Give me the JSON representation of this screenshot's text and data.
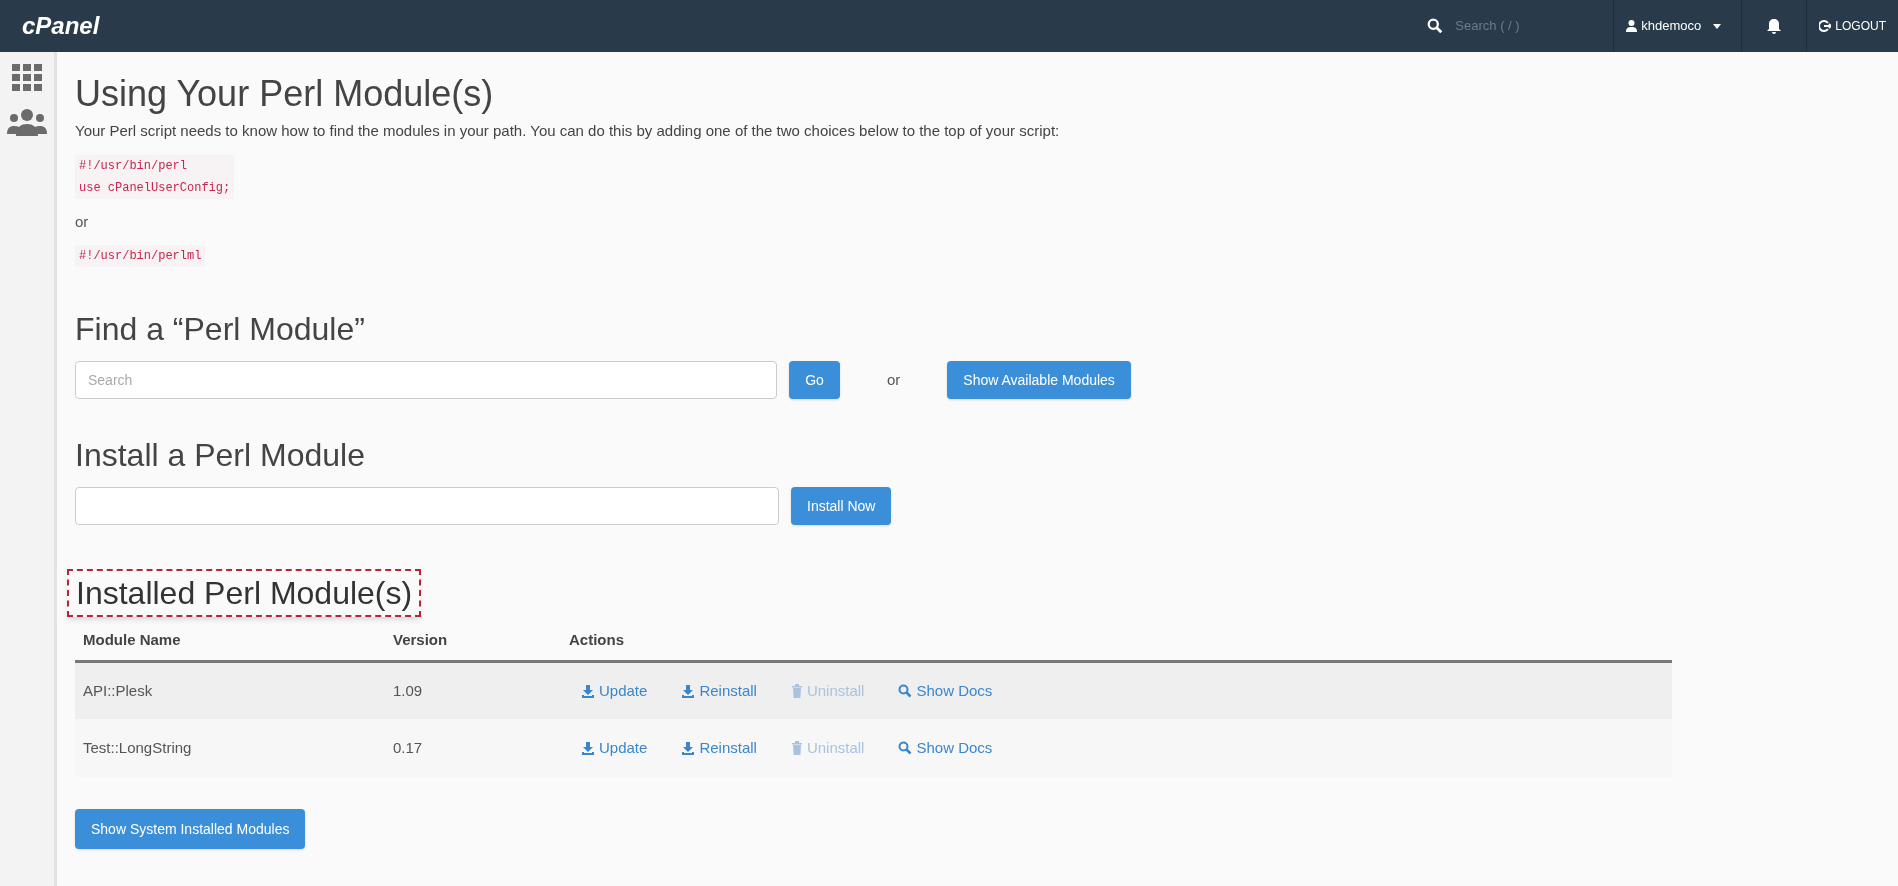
{
  "top_bar": {
    "logo": "cPanel",
    "search": {
      "placeholder": "Search ( / )"
    },
    "user": "khdemoco",
    "logout": "LOGOUT"
  },
  "usage": {
    "title": "Using Your Perl Module(s)",
    "description": "Your Perl script needs to know how to find the modules in your path. You can do this by adding one of the two choices below to the top of your script:",
    "choice_1": [
      "#!/usr/bin/perl",
      "use cPanelUserConfig;"
    ],
    "separator": "or",
    "choice_2": [
      "#!/usr/bin/perlml"
    ]
  },
  "find": {
    "title": "Find a “Perl Module”",
    "search": {
      "placeholder": "Search"
    },
    "go_button": "Go",
    "separator": "or",
    "show_available_button": "Show Available Modules"
  },
  "install": {
    "title": "Install a Perl Module",
    "install_button": "Install Now"
  },
  "installed": {
    "title": "Installed Perl Module(s)",
    "highlighted": true,
    "table": {
      "columns": [
        "Module Name",
        "Version",
        "Actions"
      ],
      "rows": [
        {
          "name": "API::Plesk",
          "version": "1.09",
          "actions": [
            {
              "kind": "update",
              "label": "Update",
              "disabled": false
            },
            {
              "kind": "reinstall",
              "label": "Reinstall",
              "disabled": false
            },
            {
              "kind": "uninstall",
              "label": "Uninstall",
              "disabled": true
            },
            {
              "kind": "docs",
              "label": "Show Docs",
              "disabled": false
            }
          ]
        },
        {
          "name": "Test::LongString",
          "version": "0.17",
          "actions": [
            {
              "kind": "update",
              "label": "Update",
              "disabled": false
            },
            {
              "kind": "reinstall",
              "label": "Reinstall",
              "disabled": false
            },
            {
              "kind": "uninstall",
              "label": "Uninstall",
              "disabled": true
            },
            {
              "kind": "docs",
              "label": "Show Docs",
              "disabled": false
            }
          ]
        }
      ]
    },
    "system_button": "Show System Installed Modules"
  }
}
